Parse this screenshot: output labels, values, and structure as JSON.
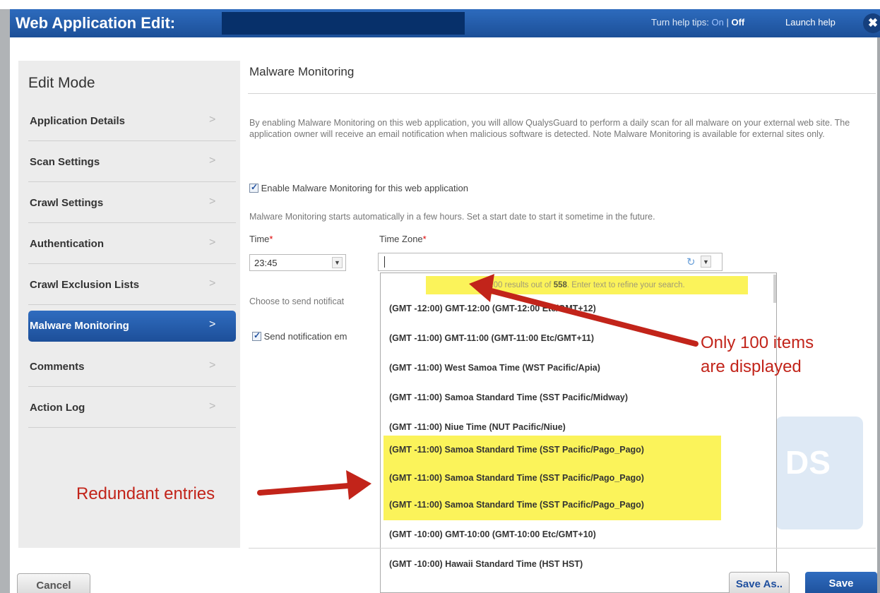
{
  "window": {
    "title": "Web Application Edit:",
    "help_prefix": "Turn help tips: ",
    "help_on": "On",
    "help_sep": " | ",
    "help_off": "Off",
    "launch_help": "Launch help",
    "close_icon": "close-icon"
  },
  "sidebar": {
    "heading": "Edit Mode",
    "items": [
      {
        "label": "Application Details"
      },
      {
        "label": "Scan Settings"
      },
      {
        "label": "Crawl Settings"
      },
      {
        "label": "Authentication"
      },
      {
        "label": "Crawl Exclusion Lists"
      },
      {
        "label": "Malware Monitoring",
        "active": true
      },
      {
        "label": "Comments"
      },
      {
        "label": "Action Log"
      }
    ],
    "chevron": ">"
  },
  "main": {
    "title": "Malware Monitoring",
    "description": "By enabling Malware Monitoring on this web application, you will allow QualysGuard to perform a daily scan for all malware on your external web site. The application owner will receive an email notification when malicious software is detected. Note Malware Monitoring is available for external sites only.",
    "enable_label": "Enable Malware Monitoring for this web application",
    "enable_checked": true,
    "starts_note": "Malware Monitoring starts automatically in a few hours. Set a start date to start it sometime in the future.",
    "time_label": "Time",
    "time_value": "23:45",
    "tz_label": "Time Zone",
    "required_mark": "*",
    "tz_value": "",
    "choose_note": "Choose to send notificat",
    "send_label": "Send notification em",
    "send_checked": true,
    "bg_logo_text": "DS"
  },
  "dropdown": {
    "summary_prefix": "100 results out of ",
    "summary_total": "558",
    "summary_suffix": ". Enter text to refine your search.",
    "options": [
      {
        "label": "(GMT -12:00) GMT-12:00 (GMT-12:00 Etc/GMT+12)",
        "highlight": false
      },
      {
        "label": "(GMT -11:00) GMT-11:00 (GMT-11:00 Etc/GMT+11)",
        "highlight": false
      },
      {
        "label": "(GMT -11:00) West Samoa Time (WST Pacific/Apia)",
        "highlight": false
      },
      {
        "label": "(GMT -11:00) Samoa Standard Time (SST Pacific/Midway)",
        "highlight": false
      },
      {
        "label": "(GMT -11:00) Niue Time (NUT Pacific/Niue)",
        "highlight": false
      },
      {
        "label": "(GMT -11:00) Samoa Standard Time (SST Pacific/Pago_Pago)",
        "highlight": true
      },
      {
        "label": "(GMT -11:00) Samoa Standard Time (SST Pacific/Pago_Pago)",
        "highlight": true
      },
      {
        "label": "(GMT -11:00) Samoa Standard Time (SST Pacific/Pago_Pago)",
        "highlight": true
      },
      {
        "label": "(GMT -10:00) GMT-10:00 (GMT-10:00 Etc/GMT+10)",
        "highlight": false
      },
      {
        "label": "(GMT -10:00) Hawaii Standard Time (HST HST)",
        "highlight": false
      }
    ]
  },
  "annotations": {
    "only_line1": "Only 100 items",
    "only_line2": "are displayed",
    "redundant": "Redundant entries",
    "color": "#c2241a"
  },
  "footer": {
    "cancel": "Cancel",
    "save_as": "Save As..",
    "save": "Save"
  },
  "colors": {
    "accent": "#1f4f9e",
    "highlight": "#fbf35a",
    "annotation": "#c2241a"
  }
}
